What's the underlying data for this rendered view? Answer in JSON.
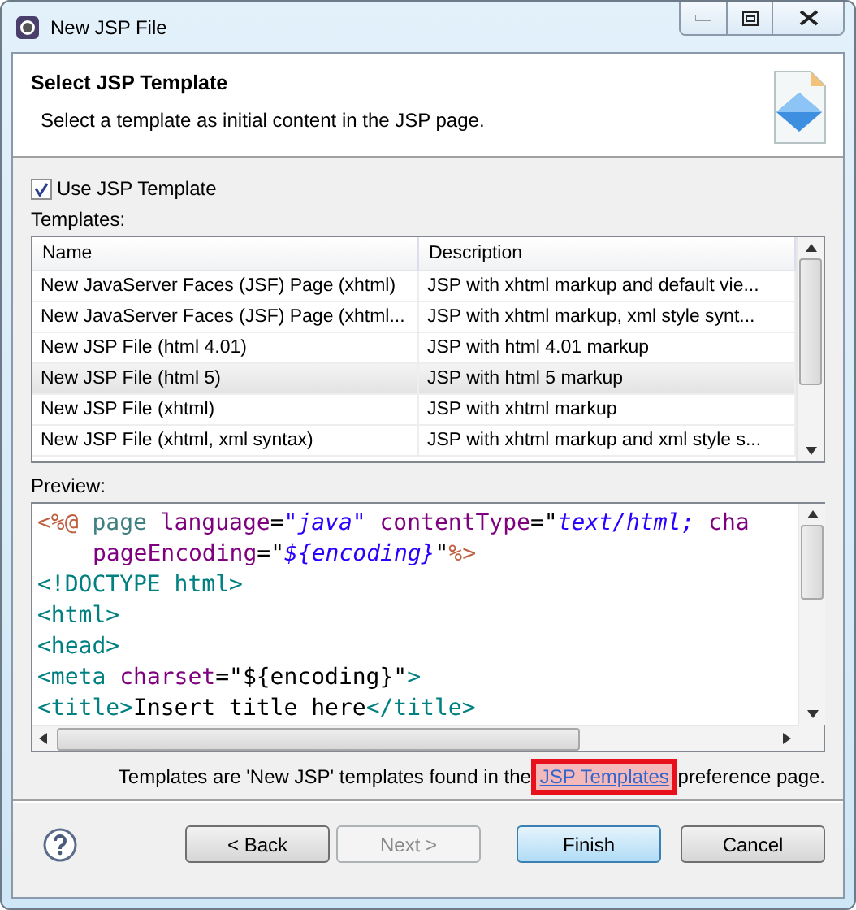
{
  "window": {
    "title": "New JSP File"
  },
  "header": {
    "title": "Select JSP Template",
    "description": "Select a template as initial content in the JSP page."
  },
  "use_template": {
    "label": "Use JSP Template",
    "checked": true
  },
  "templates": {
    "label": "Templates:",
    "columns": [
      "Name",
      "Description"
    ],
    "rows": [
      {
        "name": "New JavaServer Faces (JSF) Page (xhtml)",
        "description": "JSP with xhtml markup and default vie...",
        "selected": false
      },
      {
        "name": "New JavaServer Faces (JSF) Page (xhtml...",
        "description": "JSP with xhtml markup, xml style synt...",
        "selected": false
      },
      {
        "name": "New JSP File (html 4.01)",
        "description": "JSP with html 4.01 markup",
        "selected": false
      },
      {
        "name": "New JSP File (html 5)",
        "description": "JSP with html 5 markup",
        "selected": true
      },
      {
        "name": "New JSP File (xhtml)",
        "description": "JSP with xhtml markup",
        "selected": false
      },
      {
        "name": "New JSP File (xhtml, xml syntax)",
        "description": "JSP with xhtml markup and xml style s...",
        "selected": false
      }
    ]
  },
  "preview": {
    "label": "Preview:",
    "lines": [
      [
        {
          "kind": "directive",
          "text": "<%@"
        },
        {
          "kind": "keyword",
          "text": " page"
        },
        {
          "kind": "attr",
          "text": " language"
        },
        {
          "kind": "plain",
          "text": "="
        },
        {
          "kind": "value",
          "text": "\"java\""
        },
        {
          "kind": "attr",
          "text": " contentType"
        },
        {
          "kind": "plain",
          "text": "=\""
        },
        {
          "kind": "value",
          "text": "text/html; "
        },
        {
          "kind": "attr",
          "text": "cha"
        }
      ],
      [
        {
          "kind": "indent"
        },
        {
          "kind": "attr",
          "text": "pageEncoding"
        },
        {
          "kind": "plain",
          "text": "=\""
        },
        {
          "kind": "value",
          "text": "${encoding}"
        },
        {
          "kind": "plain",
          "text": "\""
        },
        {
          "kind": "directive",
          "text": "%>"
        }
      ],
      [
        {
          "kind": "tag",
          "text": "<!DOCTYPE html>"
        }
      ],
      [
        {
          "kind": "tag",
          "text": "<html>"
        }
      ],
      [
        {
          "kind": "tag",
          "text": "<head>"
        }
      ],
      [
        {
          "kind": "tag",
          "text": "<meta"
        },
        {
          "kind": "attr",
          "text": " charset"
        },
        {
          "kind": "plain",
          "text": "=\"${encoding}\""
        },
        {
          "kind": "tag",
          "text": ">"
        }
      ],
      [
        {
          "kind": "tag",
          "text": "<title>"
        },
        {
          "kind": "plain",
          "text": "Insert title here"
        },
        {
          "kind": "tag",
          "text": "</title>"
        }
      ]
    ]
  },
  "info": {
    "before": "Templates are 'New JSP' templates found in the",
    "link": "JSP Templates",
    "after": "preference page.",
    "link_highlighted": true
  },
  "buttons": [
    {
      "label": "< Back",
      "disabled": false,
      "default": false
    },
    {
      "label": "Next >",
      "disabled": true,
      "default": false
    },
    {
      "label": "Finish",
      "disabled": false,
      "default": true
    },
    {
      "label": "Cancel",
      "disabled": false,
      "default": false
    }
  ]
}
